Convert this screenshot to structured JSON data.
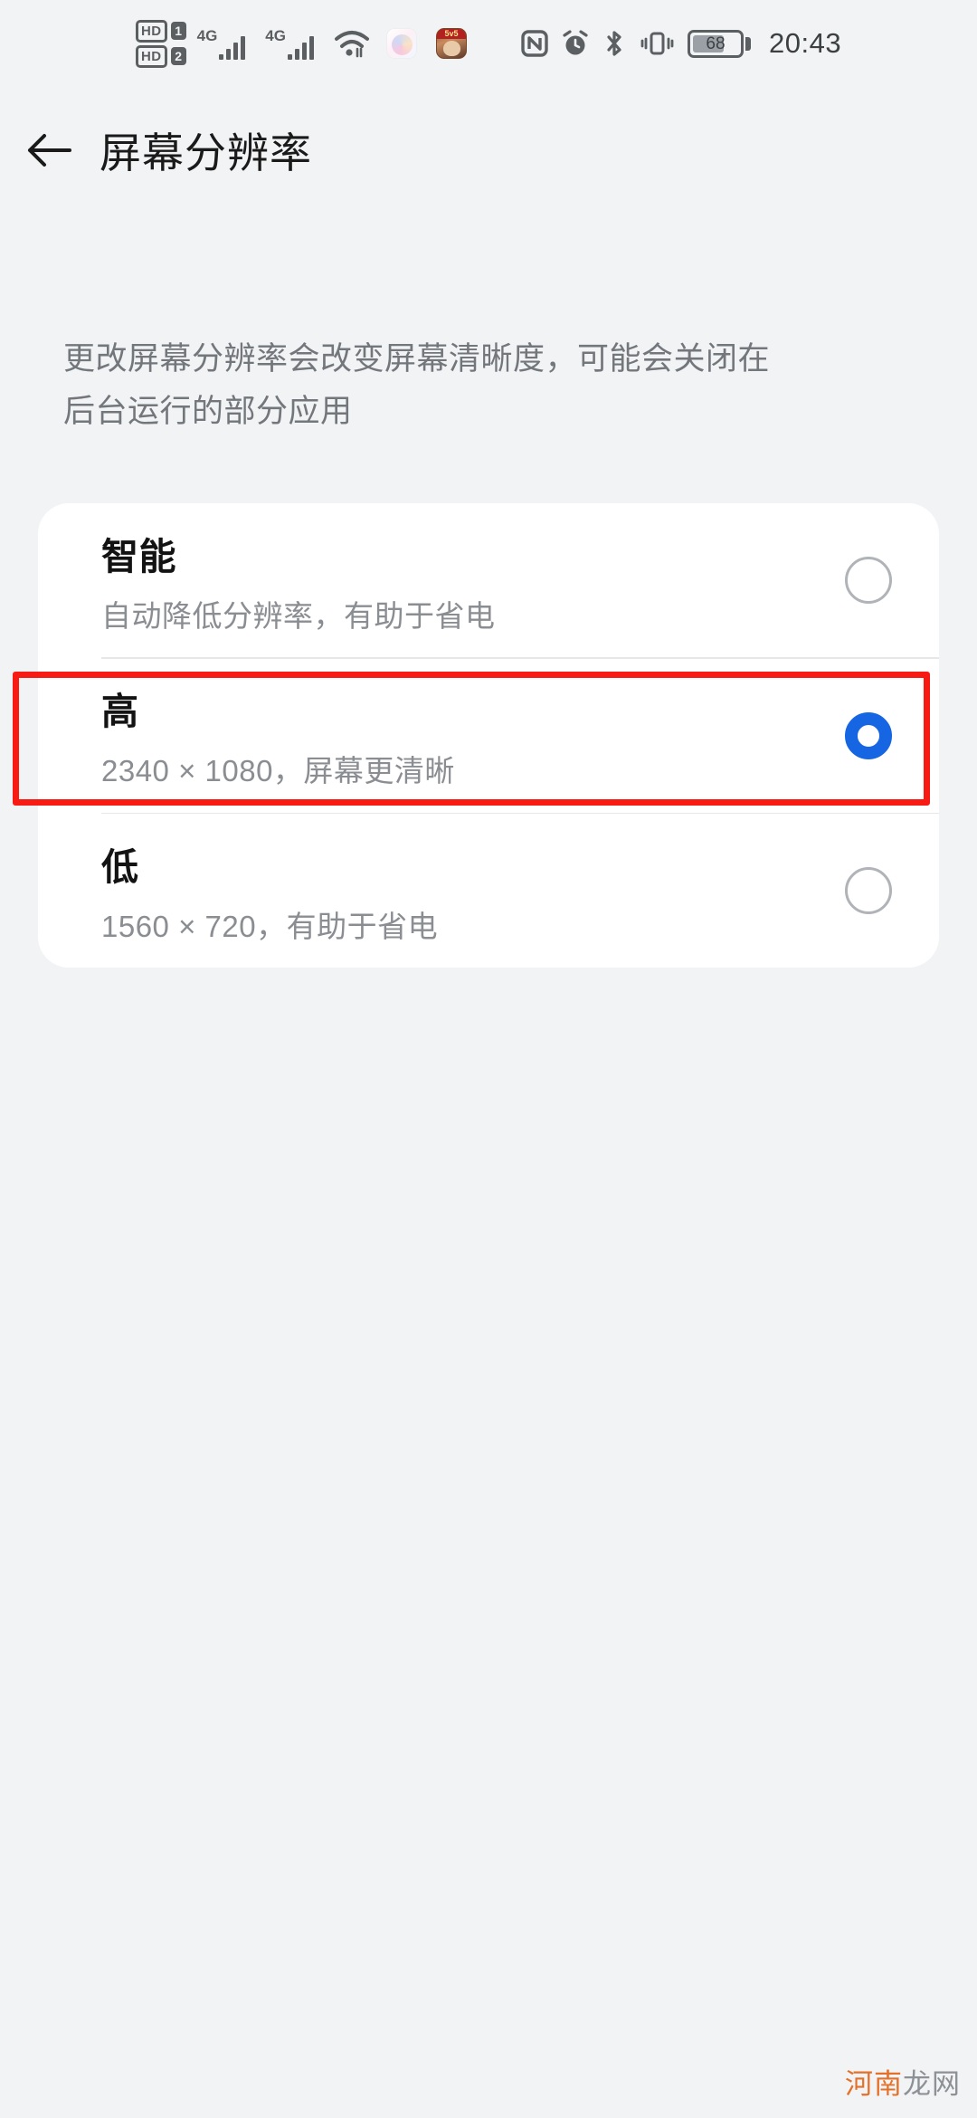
{
  "statusbar": {
    "hd_label_1": "HD",
    "hd_index_1": "1",
    "hd_label_2": "HD",
    "hd_index_2": "2",
    "sim1_network": "4G",
    "sim2_network": "4G",
    "icons": [
      "hd1-icon",
      "hd2-icon",
      "signal-sim1-icon",
      "signal-sim2-icon",
      "wifi-icon",
      "app-gallery-icon",
      "app-game-icon",
      "nfc-icon",
      "alarm-icon",
      "bluetooth-icon",
      "vibrate-icon",
      "battery-icon"
    ],
    "battery_percent": "68",
    "time": "20:43"
  },
  "header": {
    "back_icon": "back-arrow-icon",
    "title": "屏幕分辨率"
  },
  "description": {
    "line1": "更改屏幕分辨率会改变屏幕清晰度，可能会关闭在",
    "line2": "后台运行的部分应用"
  },
  "options": [
    {
      "title": "智能",
      "subtitle": "自动降低分辨率，有助于省电",
      "selected": false
    },
    {
      "title": "高",
      "subtitle": "2340 × 1080，屏幕更清晰",
      "selected": true
    },
    {
      "title": "低",
      "subtitle": "1560 × 720，有助于省电",
      "selected": false
    }
  ],
  "annotation": {
    "highlight_color": "#f81b13",
    "highlights_option_index": 1
  },
  "colors": {
    "accent": "#1665e3",
    "background": "#f1f3f4",
    "card": "#ffffff",
    "title_text": "#131313",
    "secondary_text": "#8a8d91"
  },
  "watermark": {
    "part_a": "河南",
    "part_b": "龙网"
  }
}
